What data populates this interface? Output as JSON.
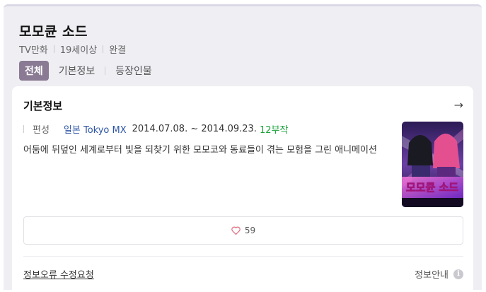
{
  "header": {
    "title": "모모큔 소드",
    "meta": [
      "TV만화",
      "19세이상",
      "완결"
    ]
  },
  "tabs": [
    {
      "label": "전체",
      "active": true
    },
    {
      "label": "기본정보",
      "active": false
    },
    {
      "label": "등장인물",
      "active": false
    }
  ],
  "card": {
    "title": "기본정보",
    "arrow_icon": "arrow-right-icon",
    "info": {
      "label": "편성",
      "broadcaster": "일본 Tokyo MX",
      "date_range": "2014.07.08. ~ 2014.09.23.",
      "episodes": "12부작"
    },
    "description": "어둠에 뒤덮인 세계로부터 빛을 되찾기 위한 모모코와 동료들이 겪는 모험을 그린 애니메이션",
    "poster": {
      "logo_text": "모모큔 소드"
    },
    "likes": "59",
    "report_link": "정보오류 수정요청",
    "guide_label": "정보안내",
    "guide_icon_glyph": "i"
  },
  "colors": {
    "active_tab": "#8a7a93",
    "link": "#2d55a6",
    "episodes": "#1ba339",
    "heart": "#e06b7d"
  }
}
